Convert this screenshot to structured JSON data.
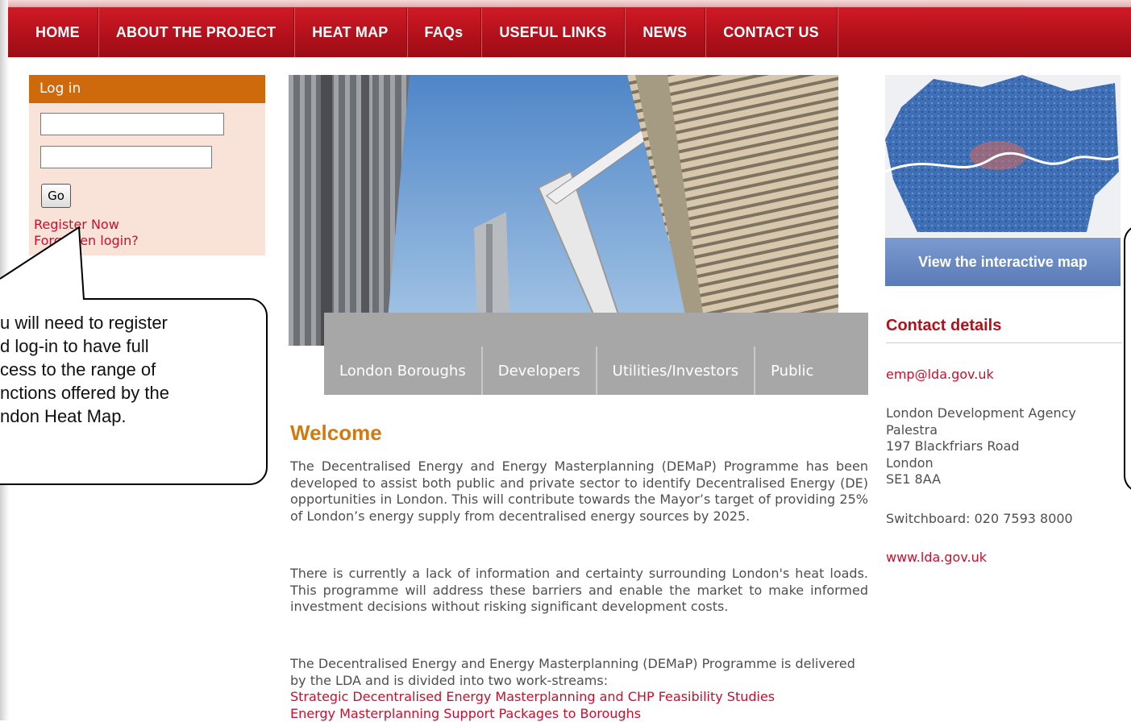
{
  "nav": {
    "items": [
      "HOME",
      "ABOUT THE PROJECT",
      "HEAT MAP",
      "FAQs",
      "USEFUL LINKS",
      "NEWS",
      "CONTACT US"
    ]
  },
  "login": {
    "title": "Log in",
    "go_label": "Go",
    "register_label": "Register Now",
    "forgot_label": "Forgotten login?"
  },
  "callout": {
    "text": "u will need to register\nd log-in to have full\ncess to the range of\nnctions offered by the\nndon Heat Map."
  },
  "tabs": [
    "London Boroughs",
    "Developers",
    "Utilities/Investors",
    "Public"
  ],
  "welcome": {
    "title": "Welcome",
    "p1": "The Decentralised Energy and Energy Masterplanning (DEMaP) Programme has been developed to assist both public and private sector to identify Decentralised Energy (DE) opportunities in London. This will contribute towards the Mayor’s target of providing 25% of London’s energy supply from decentralised energy sources by 2025.",
    "p2": "There is currently a lack of information and certainty surrounding London's heat loads. This programme will address these barriers and enable the market to make informed investment decisions without risking significant development costs.",
    "p3": "The Decentralised Energy and Energy Masterplanning (DEMaP) Programme is delivered by the LDA and is divided into two work-streams:",
    "link1": "Strategic Decentralised Energy Masterplanning and CHP Feasibility Studies",
    "link2": "Energy Masterplanning Support Packages to Boroughs"
  },
  "sidebar": {
    "map_button": "View the interactive map",
    "contact_title": "Contact details",
    "email": "emp@lda.gov.uk",
    "address": [
      "London Development Agency",
      "Palestra",
      "197 Blackfriars Road",
      "London",
      "SE1 8AA"
    ],
    "phone": "Switchboard: 020 7593 8000",
    "website": "www.lda.gov.uk"
  },
  "colors": {
    "nav_red": "#b3111c",
    "login_header": "#cf6a0c",
    "login_bg": "#f9e3d9",
    "link_red": "#c8102e",
    "welcome_orange": "#d07a12",
    "map_button_blue": "#5a7bb7"
  }
}
